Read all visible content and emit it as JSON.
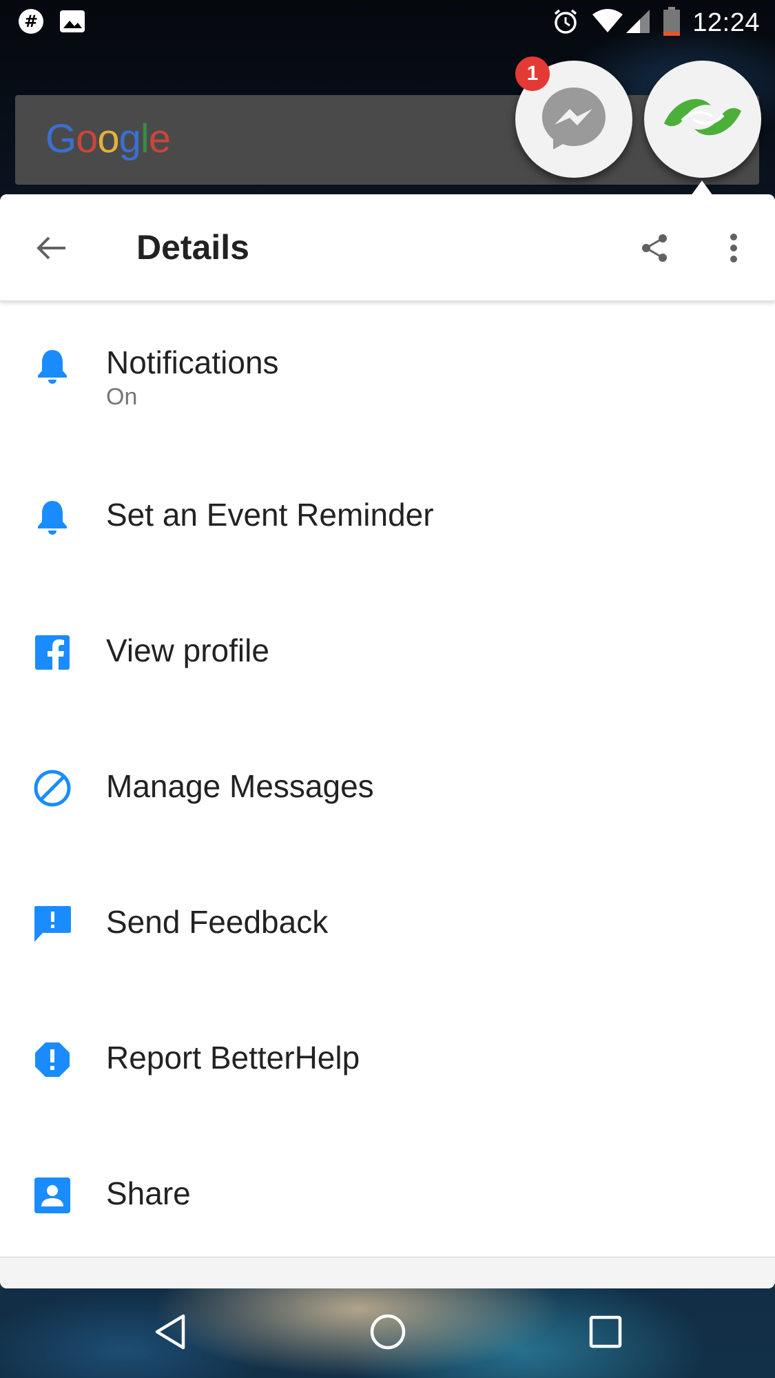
{
  "status_bar": {
    "time": "12:24",
    "icons": [
      "slack-icon",
      "image-icon",
      "alarm-icon",
      "wifi-icon",
      "signal-icon",
      "battery-icon"
    ]
  },
  "google_widget": {
    "logo_letters": [
      "G",
      "o",
      "o",
      "g",
      "l",
      "e"
    ]
  },
  "chat_heads": {
    "messenger_badge": "1",
    "icons": [
      "messenger-icon",
      "betterhelp-logo-icon"
    ]
  },
  "app_bar": {
    "title": "Details",
    "icons": [
      "back-arrow-icon",
      "share-icon",
      "more-vert-icon"
    ]
  },
  "menu": {
    "items": [
      {
        "label": "Notifications",
        "sublabel": "On",
        "icon": "bell-icon"
      },
      {
        "label": "Set an Event Reminder",
        "icon": "bell-icon"
      },
      {
        "label": "View profile",
        "icon": "facebook-icon"
      },
      {
        "label": "Manage Messages",
        "icon": "block-icon"
      },
      {
        "label": "Send Feedback",
        "icon": "feedback-icon"
      },
      {
        "label": "Report BetterHelp",
        "icon": "report-icon"
      },
      {
        "label": "Share",
        "icon": "account-box-icon"
      }
    ]
  },
  "colors": {
    "accent": "#1a8cff",
    "badge": "#e53935",
    "betterhelp_green": "#4caf3a"
  },
  "nav_bar": {
    "icons": [
      "back-nav-icon",
      "home-nav-icon",
      "recents-nav-icon"
    ]
  }
}
